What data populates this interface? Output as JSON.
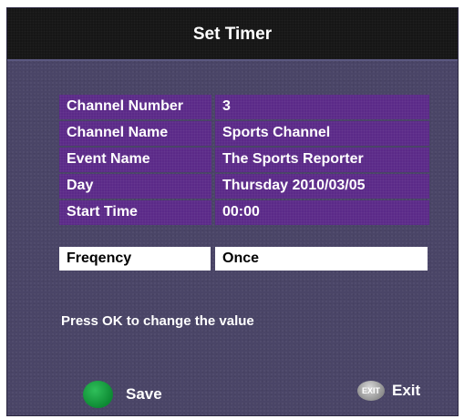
{
  "title": "Set Timer",
  "info_rows": [
    {
      "label": "Channel Number",
      "value": "3"
    },
    {
      "label": "Channel Name",
      "value": "Sports Channel"
    },
    {
      "label": "Event Name",
      "value": "The Sports Reporter"
    },
    {
      "label": "Day",
      "value": "Thursday 2010/03/05"
    },
    {
      "label": "Start Time",
      "value": "00:00"
    }
  ],
  "frequency": {
    "label": "Freqency",
    "value": "Once"
  },
  "hint": "Press OK to change the value",
  "footer": {
    "save_label": "Save",
    "exit_icon_text": "EXIT",
    "exit_label": "Exit"
  },
  "colors": {
    "background": "#4a4567",
    "title_bar": "#161616",
    "cell_purple": "#5b2a88",
    "selected_cell": "#ffffff",
    "save_button": "#0d8a33"
  },
  "icons": {
    "save": "green-circle-icon",
    "exit": "exit-icon"
  }
}
